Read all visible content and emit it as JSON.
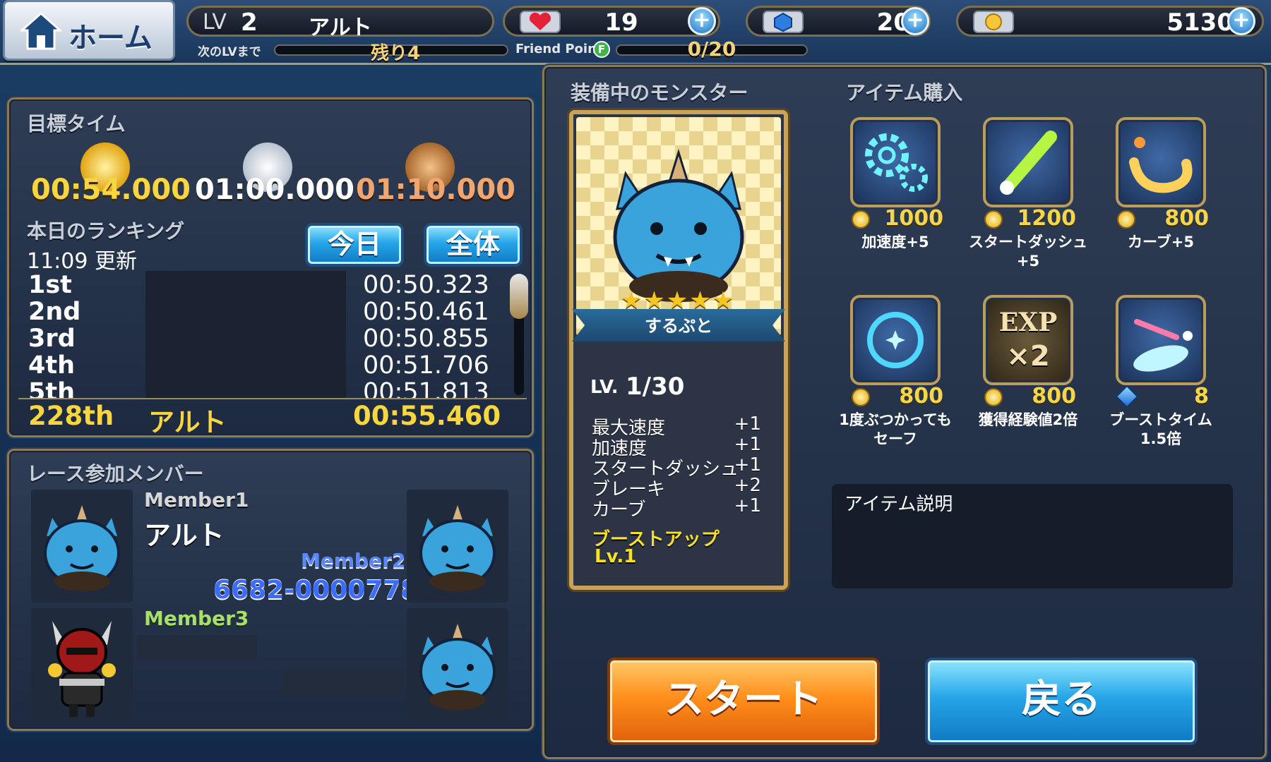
{
  "header": {
    "home_label": "ホーム",
    "lv_label": "LV",
    "level": "2",
    "player_name": "アルト",
    "next_lv_label": "次のLVまで",
    "next_lv_value": "残り4",
    "friend_point_label": "Friend Point",
    "friend_point_icon": "F",
    "friend_point_value": "0/20",
    "hearts": "19",
    "gems": "20",
    "coins": "5130",
    "plus_symbol": "+"
  },
  "target_time": {
    "title": "目標タイム",
    "gold": "00:54.000",
    "silver": "01:00.000",
    "bronze": "01:10.000"
  },
  "ranking": {
    "title": "本日のランキング",
    "updated": "11:09 更新",
    "tab_today": "今日",
    "tab_all": "全体",
    "rows": [
      {
        "rank": "1st",
        "time": "00:50.323"
      },
      {
        "rank": "2nd",
        "time": "00:50.461"
      },
      {
        "rank": "3rd",
        "time": "00:50.855"
      },
      {
        "rank": "4th",
        "time": "00:51.706"
      },
      {
        "rank": "5th",
        "time": "00:51.813"
      }
    ],
    "me": {
      "rank": "228th",
      "name": "アルト",
      "time": "00:55.460"
    }
  },
  "members": {
    "title": "レース参加メンバー",
    "member1_label": "Member1",
    "member1_name": "アルト",
    "member2_label": "Member2",
    "member2_id": "6682-0000778",
    "member3_label": "Member3"
  },
  "equipped": {
    "title": "装備中のモンスター",
    "monster_name": "するぷと",
    "stars": 5,
    "lv_prefix": "LV.",
    "lv_value": "1/30",
    "stats": [
      {
        "name": "最大速度",
        "value": "+1"
      },
      {
        "name": "加速度",
        "value": "+1"
      },
      {
        "name": "スタートダッシュ",
        "value": "+1"
      },
      {
        "name": "ブレーキ",
        "value": "+2"
      },
      {
        "name": "カーブ",
        "value": "+1"
      }
    ],
    "boost_label": "ブーストアップ",
    "boost_level": "Lv.1"
  },
  "shop": {
    "title": "アイテム購入",
    "items": [
      {
        "price": "1000",
        "name": "加速度+5",
        "icon": "gears-icon"
      },
      {
        "price": "1200",
        "name": "スタートダッシュ+5",
        "icon": "comet-icon"
      },
      {
        "price": "800",
        "name": "カーブ+5",
        "icon": "curve-icon"
      },
      {
        "price": "800",
        "name": "1度ぶつかってもセーフ",
        "icon": "shield-ring-icon"
      },
      {
        "price": "800",
        "name": "獲得経験値2倍",
        "icon": "exp-x2-icon"
      },
      {
        "price": "8",
        "name": "ブーストタイム1.5倍",
        "icon": "boost-icon"
      }
    ],
    "exp_text": "EXP",
    "x2_text": "×2",
    "description_title": "アイテム説明"
  },
  "buttons": {
    "start": "スタート",
    "back": "戻る"
  },
  "colors": {
    "accent_gold": "#f7d640",
    "member2_blue": "#4d7dff",
    "member3_green": "#a6e06a",
    "start_orange": "#ff8f1c",
    "back_blue": "#26a5e8"
  }
}
